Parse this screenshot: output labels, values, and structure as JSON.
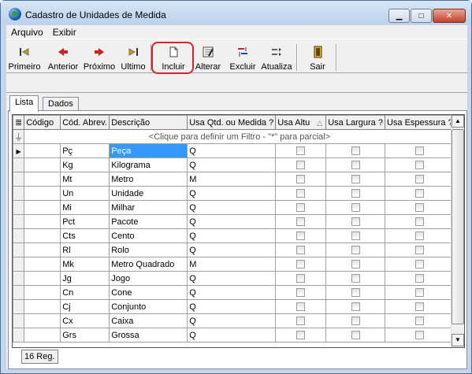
{
  "window": {
    "title": "Cadastro de Unidades de Medida"
  },
  "controls": {
    "minimize": "▁",
    "maximize": "□",
    "close": "✕"
  },
  "menu": [
    "Arquivo",
    "Exibir"
  ],
  "toolbar": [
    {
      "label": "Primeiro",
      "icon": "first-icon"
    },
    {
      "label": "Anterior",
      "icon": "prev-icon"
    },
    {
      "label": "Próximo",
      "icon": "next-icon"
    },
    {
      "label": "Ultimo",
      "icon": "last-icon"
    },
    {
      "label": "Incluir",
      "icon": "new-doc-icon"
    },
    {
      "label": "Alterar",
      "icon": "edit-icon"
    },
    {
      "label": "Excluir",
      "icon": "delete-icon"
    },
    {
      "label": "Atualiza",
      "icon": "refresh-icon"
    },
    {
      "label": "Sair",
      "icon": "exit-icon"
    }
  ],
  "tabs": [
    "Lista",
    "Dados"
  ],
  "grid": {
    "columns": [
      "Código",
      "Cód. Abrev.",
      "Descrição",
      "Usa Qtd. ou Medida ?",
      "Usa Altu",
      "Usa Largura ?",
      "Usa Espessura ?"
    ],
    "sort_indicator": "△",
    "filter_hint": "<Clique para definir um Filtro - \"*\" para parcial>",
    "rows": [
      {
        "codigo": "",
        "abrev": "Pç",
        "descricao": "Peça",
        "usa": "Q"
      },
      {
        "codigo": "",
        "abrev": "Kg",
        "descricao": "Kilograma",
        "usa": "Q"
      },
      {
        "codigo": "",
        "abrev": "Mt",
        "descricao": "Metro",
        "usa": "M"
      },
      {
        "codigo": "",
        "abrev": "Un",
        "descricao": "Unidade",
        "usa": "Q"
      },
      {
        "codigo": "",
        "abrev": "Mi",
        "descricao": "Milhar",
        "usa": "Q"
      },
      {
        "codigo": "",
        "abrev": "Pct",
        "descricao": "Pacote",
        "usa": "Q"
      },
      {
        "codigo": "",
        "abrev": "Cts",
        "descricao": "Cento",
        "usa": "Q"
      },
      {
        "codigo": "",
        "abrev": "Rl",
        "descricao": "Rolo",
        "usa": "Q"
      },
      {
        "codigo": "",
        "abrev": "Mk",
        "descricao": "Metro Quadrado",
        "usa": "M"
      },
      {
        "codigo": "",
        "abrev": "Jg",
        "descricao": "Jogo",
        "usa": "Q"
      },
      {
        "codigo": "",
        "abrev": "Cn",
        "descricao": "Cone",
        "usa": "Q"
      },
      {
        "codigo": "",
        "abrev": "Cj",
        "descricao": "Conjunto",
        "usa": "Q"
      },
      {
        "codigo": "",
        "abrev": "Cx",
        "descricao": "Caixa",
        "usa": "Q"
      },
      {
        "codigo": "",
        "abrev": "Grs",
        "descricao": "Grossa",
        "usa": "Q"
      }
    ]
  },
  "status": {
    "count": "16 Reg."
  },
  "colors": {
    "highlight": "#d8232a",
    "selection": "#3399ff"
  }
}
